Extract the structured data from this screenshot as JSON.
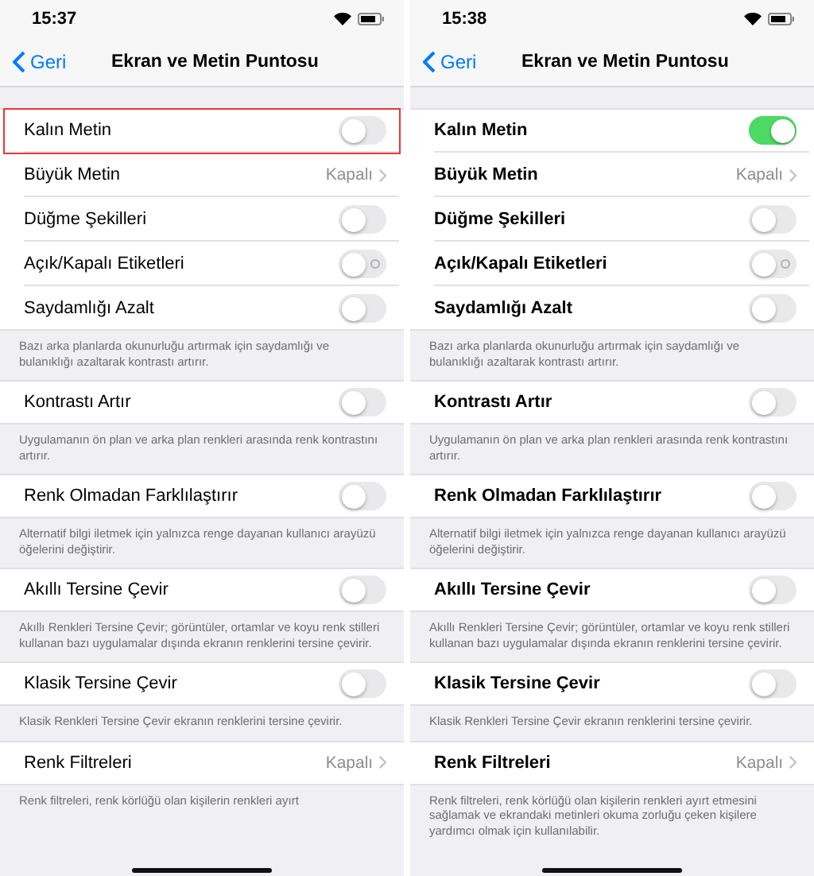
{
  "panels": [
    {
      "time": "15:37",
      "back": "Geri",
      "title": "Ekran ve Metin Puntosu",
      "bold_text": false,
      "sections": [
        {
          "rows": [
            {
              "kind": "toggle",
              "label": "Kalın Metin",
              "on": false,
              "highlighted": true
            },
            {
              "kind": "link",
              "label": "Büyük Metin",
              "value": "Kapalı"
            },
            {
              "kind": "toggle",
              "label": "Düğme Şekilleri",
              "on": false
            },
            {
              "kind": "toggle",
              "label": "Açık/Kapalı Etiketleri",
              "on": false,
              "off_label": true
            },
            {
              "kind": "toggle",
              "label": "Saydamlığı Azalt",
              "on": false
            }
          ],
          "footer": "Bazı arka planlarda okunurluğu artırmak için saydamlığı ve bulanıklığı azaltarak kontrastı artırır."
        },
        {
          "rows": [
            {
              "kind": "toggle",
              "label": "Kontrastı Artır",
              "on": false
            }
          ],
          "footer": "Uygulamanın ön plan ve arka plan renkleri arasında renk kontrastını artırır."
        },
        {
          "rows": [
            {
              "kind": "toggle",
              "label": "Renk Olmadan Farklılaştırır",
              "on": false
            }
          ],
          "footer": "Alternatif bilgi iletmek için yalnızca renge dayanan kullanıcı arayüzü öğelerini değiştirir."
        },
        {
          "rows": [
            {
              "kind": "toggle",
              "label": "Akıllı Tersine Çevir",
              "on": false
            }
          ],
          "footer": "Akıllı Renkleri Tersine Çevir; görüntüler, ortamlar ve koyu renk stilleri kullanan bazı uygulamalar dışında ekranın renklerini tersine çevirir."
        },
        {
          "rows": [
            {
              "kind": "toggle",
              "label": "Klasik Tersine Çevir",
              "on": false
            }
          ],
          "footer": "Klasik Renkleri Tersine Çevir ekranın renklerini tersine çevirir."
        },
        {
          "rows": [
            {
              "kind": "link",
              "label": "Renk Filtreleri",
              "value": "Kapalı"
            }
          ],
          "footer": "Renk filtreleri, renk körlüğü olan kişilerin renkleri ayırt"
        }
      ]
    },
    {
      "time": "15:38",
      "back": "Geri",
      "title": "Ekran ve Metin Puntosu",
      "bold_text": true,
      "sections": [
        {
          "rows": [
            {
              "kind": "toggle",
              "label": "Kalın Metin",
              "on": true,
              "highlighted": false
            },
            {
              "kind": "link",
              "label": "Büyük Metin",
              "value": "Kapalı"
            },
            {
              "kind": "toggle",
              "label": "Düğme Şekilleri",
              "on": false
            },
            {
              "kind": "toggle",
              "label": "Açık/Kapalı Etiketleri",
              "on": false,
              "off_label": true
            },
            {
              "kind": "toggle",
              "label": "Saydamlığı Azalt",
              "on": false
            }
          ],
          "footer": "Bazı arka planlarda okunurluğu artırmak için saydamlığı ve bulanıklığı azaltarak kontrastı artırır."
        },
        {
          "rows": [
            {
              "kind": "toggle",
              "label": "Kontrastı Artır",
              "on": false
            }
          ],
          "footer": "Uygulamanın ön plan ve arka plan renkleri arasında renk kontrastını artırır."
        },
        {
          "rows": [
            {
              "kind": "toggle",
              "label": "Renk Olmadan Farklılaştırır",
              "on": false
            }
          ],
          "footer": "Alternatif bilgi iletmek için yalnızca renge dayanan kullanıcı arayüzü öğelerini değiştirir."
        },
        {
          "rows": [
            {
              "kind": "toggle",
              "label": "Akıllı Tersine Çevir",
              "on": false
            }
          ],
          "footer": "Akıllı Renkleri Tersine Çevir; görüntüler, ortamlar ve koyu renk stilleri kullanan bazı uygulamalar dışında ekranın renklerini tersine çevirir."
        },
        {
          "rows": [
            {
              "kind": "toggle",
              "label": "Klasik Tersine Çevir",
              "on": false
            }
          ],
          "footer": "Klasik Renkleri Tersine Çevir ekranın renklerini tersine çevirir."
        },
        {
          "rows": [
            {
              "kind": "link",
              "label": "Renk Filtreleri",
              "value": "Kapalı"
            }
          ],
          "footer": "Renk filtreleri, renk körlüğü olan kişilerin renkleri ayırt etmesini sağlamak ve ekrandaki metinleri okuma zorluğu çeken kişilere yardımcı olmak için kullanılabilir."
        }
      ]
    }
  ]
}
